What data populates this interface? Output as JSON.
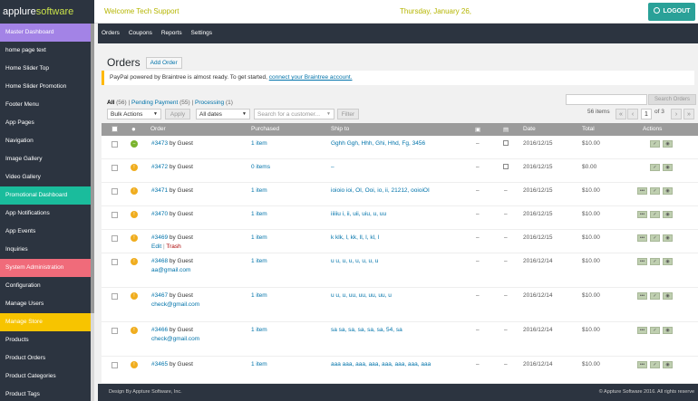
{
  "header": {
    "logo_text": "applure",
    "logo_accent": "software",
    "welcome": "Welcome Tech Support",
    "date": "Thursday, January 26,",
    "logout": "LOGOUT"
  },
  "sidebar": {
    "items": [
      {
        "label": "Master Dashboard",
        "style": "purple"
      },
      {
        "label": "home page text",
        "style": ""
      },
      {
        "label": "Home Slider Top",
        "style": ""
      },
      {
        "label": "Home Slider Promotion",
        "style": ""
      },
      {
        "label": "Footer Menu",
        "style": ""
      },
      {
        "label": "App Pages",
        "style": ""
      },
      {
        "label": "Navigation",
        "style": ""
      },
      {
        "label": "Image Gallery",
        "style": ""
      },
      {
        "label": "Video Gallery",
        "style": ""
      },
      {
        "label": "Promotional Dashboard",
        "style": "teal"
      },
      {
        "label": "App Notifications",
        "style": ""
      },
      {
        "label": "App Events",
        "style": ""
      },
      {
        "label": "Inquiries",
        "style": ""
      },
      {
        "label": "System Administration",
        "style": "red"
      },
      {
        "label": "Configuration",
        "style": ""
      },
      {
        "label": "Manage Users",
        "style": ""
      },
      {
        "label": "Manage Store",
        "style": "yellow"
      },
      {
        "label": "Products",
        "style": ""
      },
      {
        "label": "Product Orders",
        "style": ""
      },
      {
        "label": "Product Categories",
        "style": ""
      },
      {
        "label": "Product Tags",
        "style": ""
      }
    ]
  },
  "nav": {
    "items": [
      "Orders",
      "Coupons",
      "Reports",
      "Settings"
    ]
  },
  "page": {
    "title": "Orders",
    "add_order": "Add Order",
    "notice_text": "PayPal powered by Braintree is almost ready. To get started,",
    "notice_link": "connect your Braintree account.",
    "filter_all": "All",
    "filter_all_count": "(56)",
    "filter_pending": "Pending Payment",
    "filter_pending_count": "(55)",
    "filter_processing": "Processing",
    "filter_processing_count": "(1)",
    "search_button": "Search Orders",
    "bulk_actions": "Bulk Actions",
    "apply": "Apply",
    "all_dates": "All dates",
    "customer_placeholder": "Search for a customer...",
    "filter_button": "Filter",
    "items_count": "56 items",
    "page_first": "«",
    "page_prev": "‹",
    "page_current": "1",
    "page_of": "of 3",
    "page_next": "›",
    "page_last": "»"
  },
  "table": {
    "headers": {
      "order": "Order",
      "purchased": "Purchased",
      "ship_to": "Ship to",
      "date": "Date",
      "total": "Total",
      "actions": "Actions"
    },
    "rows": [
      {
        "num": "#3473",
        "by": " by Guest",
        "sub": "",
        "purchased": "1 item",
        "ship": "Gghh Ggh, Hhh, Ghi, Hhd, Fg, 3456",
        "date": "2016/12/15",
        "total": "$10.00",
        "status": "green"
      },
      {
        "num": "#3472",
        "by": " by Guest",
        "sub": "",
        "purchased": "0 items",
        "ship": "–",
        "date": "2016/12/15",
        "total": "$0.00",
        "status": "orange"
      },
      {
        "num": "#3471",
        "by": " by Guest",
        "sub": "",
        "purchased": "1 item",
        "ship": "ioioio ioi, OI, Ooi, io, ii, 21212, ooioiOI",
        "date": "2016/12/15",
        "total": "$10.00",
        "status": "orange"
      },
      {
        "num": "#3470",
        "by": " by Guest",
        "sub": "",
        "purchased": "1 item",
        "ship": "iiiiiu i, ii, uii, uiu, u, uu",
        "date": "2016/12/15",
        "total": "$10.00",
        "status": "orange"
      },
      {
        "num": "#3469",
        "by": " by Guest",
        "sub": "Edit",
        "sub_sep": " | ",
        "sub2": "Trash",
        "purchased": "1 item",
        "ship": "k klk, l, kk, ll, l, kl, l",
        "date": "2016/12/15",
        "total": "$10.00",
        "status": "orange"
      },
      {
        "num": "#3468",
        "by": " by Guest",
        "sub": "aa@gmail.com",
        "purchased": "1 item",
        "ship": "u u, u, u, u, u, u, u",
        "date": "2016/12/14",
        "total": "$10.00",
        "status": "orange"
      },
      {
        "num": "#3467",
        "by": " by Guest",
        "sub": "check@gmail.com",
        "purchased": "1 item",
        "ship": "u u, u, uu, uu, uu, uu, u",
        "date": "2016/12/14",
        "total": "$10.00",
        "status": "orange"
      },
      {
        "num": "#3466",
        "by": " by Guest",
        "sub": "check@gmail.com",
        "purchased": "1 item",
        "ship": "sa sa, sa, sa, sa, sa, 54, sa",
        "date": "2016/12/14",
        "total": "$10.00",
        "status": "orange"
      },
      {
        "num": "#3465",
        "by": " by Guest",
        "sub": "",
        "purchased": "1 item",
        "ship": "aaa aaa, aaa, aaa, aaa, aaa, aaa, aaa",
        "date": "2016/12/14",
        "total": "$10.00",
        "status": "orange"
      }
    ]
  },
  "footer": {
    "left": "Design By Appture Software, Inc.",
    "right": "© Appture Software 2016. All rights reserve"
  },
  "colors": {
    "sidebar_bg": "#2c3440",
    "accent_teal": "#2aa198",
    "link": "#0073aa"
  }
}
